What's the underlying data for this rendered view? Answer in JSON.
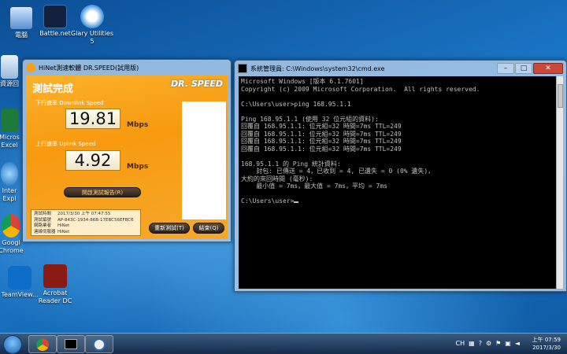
{
  "desktop": {
    "icons": [
      {
        "label": "電腦"
      },
      {
        "label": "Battle.net"
      },
      {
        "label": "Glary Utilities 5"
      },
      {
        "label": "資源回"
      },
      {
        "label": "Micros Excel"
      },
      {
        "label": "Inter Expl"
      },
      {
        "label": "Googl Chrome"
      },
      {
        "label": "TeamView..."
      },
      {
        "label": "Acrobat Reader DC"
      }
    ]
  },
  "drspeed": {
    "title": "HiNet測速軟體 DR.SPEED(試用版)",
    "brand": "DR. SPEED",
    "heading": "測試完成",
    "download_label": "下行速率 Downlink Speed",
    "download_value": "19.81",
    "upload_label": "上行速率 Uplink Speed",
    "upload_value": "4.92",
    "unit": "Mbps",
    "report_button": "開啟測試報告(R)",
    "info": [
      {
        "k": "測試時間",
        "v": "2017/3/30 上午 07:47:55"
      },
      {
        "k": "測試編號",
        "v": "AP-843C-1934-86B-17EBC56EFBC6"
      },
      {
        "k": "網路業者",
        "v": "HiNet"
      },
      {
        "k": "連線伺服器",
        "v": "HiNet"
      }
    ],
    "retest_button": "重新測試(T)",
    "exit_button": "結束(Q)"
  },
  "cmd": {
    "title": "系統管理員: C:\\Windows\\system32\\cmd.exe",
    "lines": [
      "Microsoft Windows [版本 6.1.7601]",
      "Copyright (c) 2009 Microsoft Corporation.  All rights reserved.",
      "",
      "C:\\Users\\user>ping 168.95.1.1",
      "",
      "Ping 168.95.1.1 (使用 32 位元組的資料):",
      "回覆自 168.95.1.1: 位元組=32 時間=7ms TTL=249",
      "回覆自 168.95.1.1: 位元組=32 時間=7ms TTL=249",
      "回覆自 168.95.1.1: 位元組=32 時間=7ms TTL=249",
      "回覆自 168.95.1.1: 位元組=32 時間=7ms TTL=249",
      "",
      "168.95.1.1 的 Ping 統計資料:",
      "    封包: 已傳送 = 4，已收到 = 4, 已遺失 = 0 (0% 遺失)，",
      "大約的來回時間 (毫秒):",
      "    最小值 = 7ms，最大值 = 7ms，平均 = 7ms",
      "",
      "C:\\Users\\user>"
    ]
  },
  "taskbar": {
    "lang": "CH",
    "time": "上午 07:59",
    "date": "2017/3/30"
  }
}
